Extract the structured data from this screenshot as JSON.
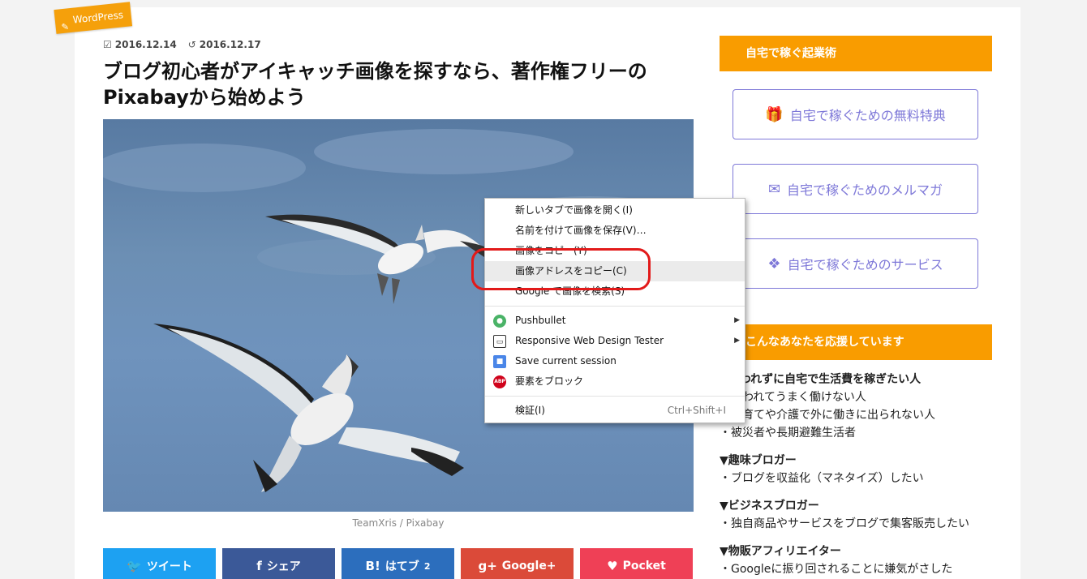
{
  "category": {
    "label": "WordPress"
  },
  "meta": {
    "published": "2016.12.14",
    "updated": "2016.12.17"
  },
  "article": {
    "title_line1": "ブログ初心者がアイキャッチ画像を探すなら、著作権フリーの",
    "title_line2": "Pixabayから始めよう",
    "image_caption": "TeamXris / Pixabay"
  },
  "share_buttons": [
    {
      "label": "ツイート",
      "icon": "twitter-bird-icon",
      "color": "#1da1f2"
    },
    {
      "label": "シェア",
      "icon": "facebook-icon",
      "color": "#3b5998"
    },
    {
      "label": "はてブ",
      "icon_text": "B!",
      "count": "2",
      "color": "#2c6ebd"
    },
    {
      "label": "Google+",
      "icon_text": "g+",
      "color": "#db4a39"
    },
    {
      "label": "Pocket",
      "icon": "pocket-icon",
      "color": "#ef4056"
    }
  ],
  "sidebar": {
    "section1_title": "自宅で稼ぐ起業術",
    "buttons": [
      {
        "label": "自宅で稼ぐための無料特典",
        "icon": "gift-icon"
      },
      {
        "label": "自宅で稼ぐためのメルマガ",
        "icon": "envelope-icon"
      },
      {
        "label": "自宅で稼ぐためのサービス",
        "icon": "cubes-icon"
      }
    ],
    "section2_title": "こんなあなたを応援しています",
    "groups": [
      {
        "heading": "▼囚われずに自宅で生活費を稼ぎたい人",
        "items": [
          "・囚われてうまく働けない人",
          "・子育てや介護で外に働きに出られない人",
          "・被災者や長期避難生活者"
        ]
      },
      {
        "heading": "▼趣味ブロガー",
        "items": [
          "・ブログを収益化（マネタイズ）したい"
        ]
      },
      {
        "heading": "▼ビジネスブロガー",
        "items": [
          "・独自商品やサービスをブログで集客販売したい"
        ]
      },
      {
        "heading": "▼物販アフィリエイター",
        "items": [
          "・Googleに振り回されることに嫌気がさした"
        ]
      }
    ]
  },
  "context_menu": {
    "items": [
      {
        "label": "新しいタブで画像を開く(I)"
      },
      {
        "label": "名前を付けて画像を保存(V)…"
      },
      {
        "label": "画像をコピー(Y)"
      },
      {
        "label": "画像アドレスをコピー(C)",
        "highlighted": true
      },
      {
        "label": "Google で画像を検索(S)"
      }
    ],
    "extensions": [
      {
        "label": "Pushbullet",
        "icon": "pushbullet-icon",
        "submenu": true
      },
      {
        "label": "Responsive Web Design Tester",
        "icon": "monitor-icon",
        "submenu": true
      },
      {
        "label": "Save current session",
        "icon": "session-icon"
      },
      {
        "label": "要素をブロック",
        "icon": "adblock-icon",
        "icon_text": "ABP"
      }
    ],
    "inspect": {
      "label": "検証(I)",
      "shortcut": "Ctrl+Shift+I"
    }
  },
  "colors": {
    "accent_orange": "#f99c00",
    "sidebar_purple": "#7e78d8",
    "highlight_red": "#e21a1a"
  }
}
